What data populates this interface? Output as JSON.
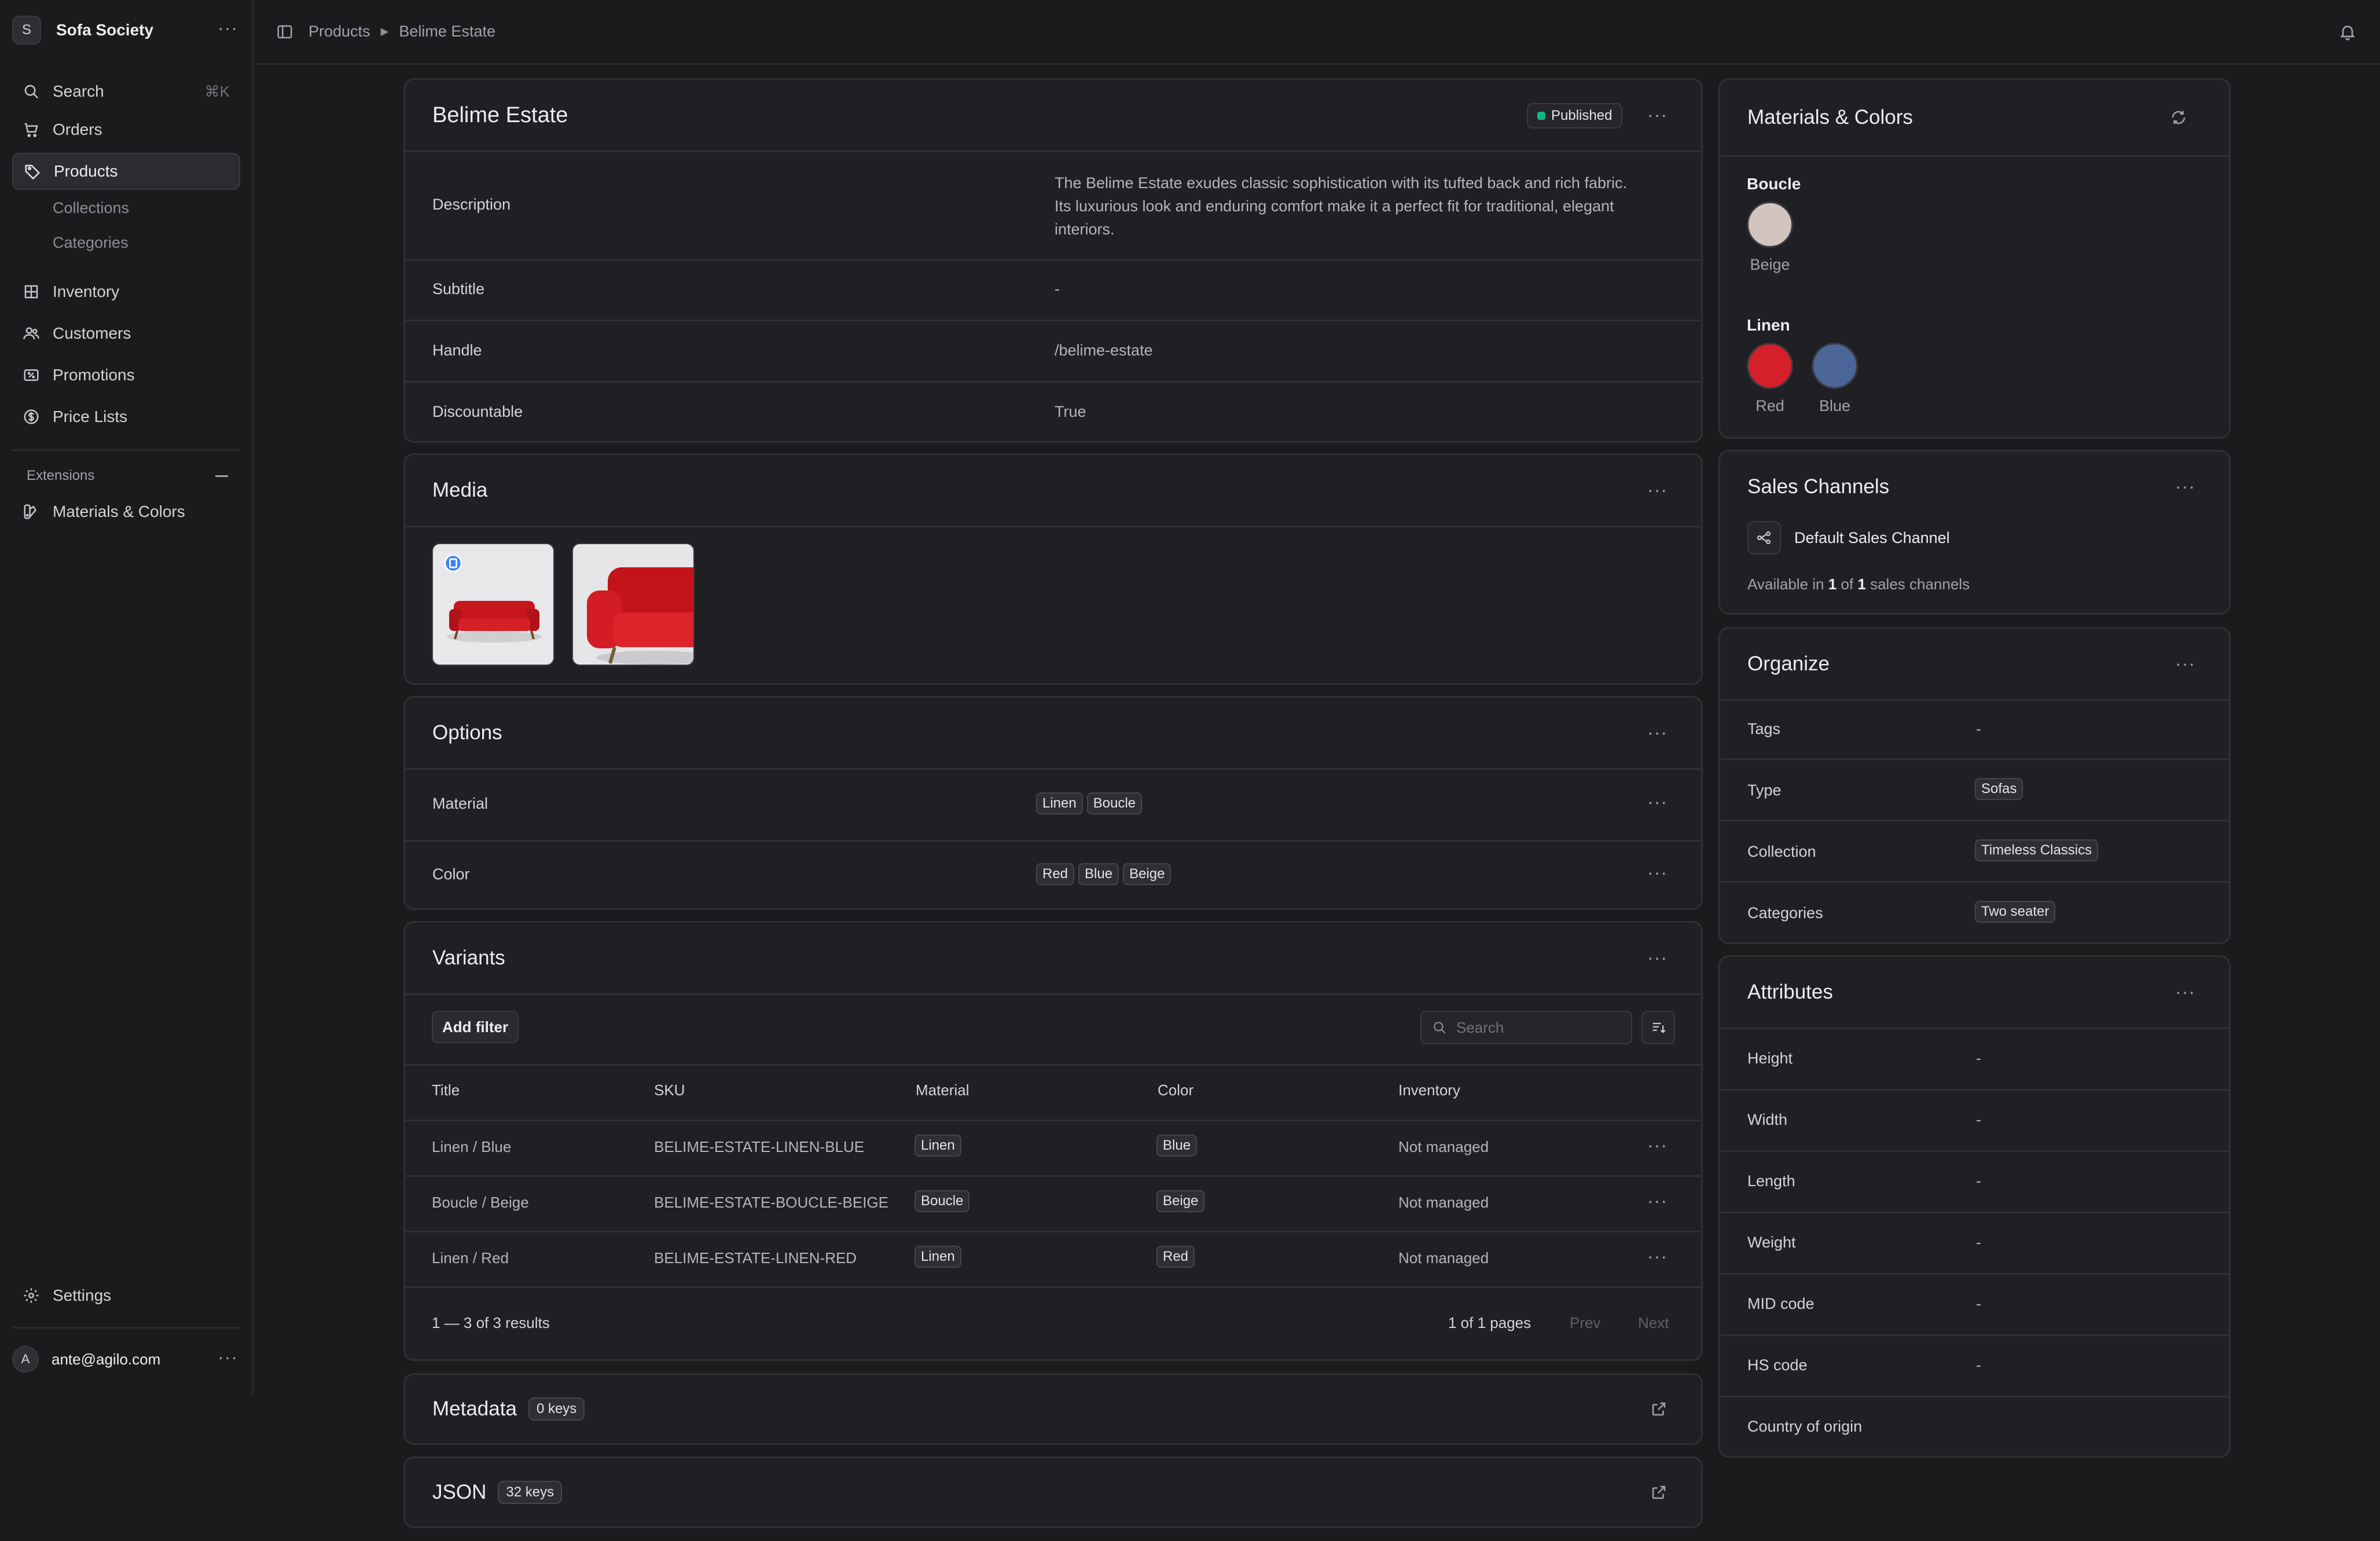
{
  "sidebar": {
    "store_initial": "S",
    "store_name": "Sofa Society",
    "nav": {
      "search": "Search",
      "search_shortcut": "⌘K",
      "orders": "Orders",
      "products": "Products",
      "collections": "Collections",
      "categories": "Categories",
      "inventory": "Inventory",
      "customers": "Customers",
      "promotions": "Promotions",
      "price_lists": "Price Lists"
    },
    "extensions_label": "Extensions",
    "extension_item": "Materials & Colors",
    "settings": "Settings",
    "user_initial": "A",
    "user_email": "ante@agilo.com"
  },
  "breadcrumb": {
    "parent": "Products",
    "current": "Belime Estate"
  },
  "product": {
    "title": "Belime Estate",
    "status": "Published",
    "status_color": "#10b981",
    "rows": {
      "description_label": "Description",
      "description_value": "The Belime Estate exudes classic sophistication with its tufted back and rich fabric. Its luxurious look and enduring comfort make it a perfect fit for traditional, elegant interiors.",
      "subtitle_label": "Subtitle",
      "subtitle_value": "-",
      "handle_label": "Handle",
      "handle_value": "/belime-estate",
      "discountable_label": "Discountable",
      "discountable_value": "True"
    }
  },
  "media": {
    "title": "Media"
  },
  "options": {
    "title": "Options",
    "material_label": "Material",
    "material_values": [
      "Linen",
      "Boucle"
    ],
    "color_label": "Color",
    "color_values": [
      "Red",
      "Blue",
      "Beige"
    ]
  },
  "variants": {
    "title": "Variants",
    "add_filter": "Add filter",
    "search_placeholder": "Search",
    "columns": [
      "Title",
      "SKU",
      "Material",
      "Color",
      "Inventory"
    ],
    "rows": [
      [
        "Linen / Blue",
        "BELIME-ESTATE-LINEN-BLUE",
        "Linen",
        "Blue",
        "Not managed"
      ],
      [
        "Boucle / Beige",
        "BELIME-ESTATE-BOUCLE-BEIGE",
        "Boucle",
        "Beige",
        "Not managed"
      ],
      [
        "Linen / Red",
        "BELIME-ESTATE-LINEN-RED",
        "Linen",
        "Red",
        "Not managed"
      ]
    ],
    "results": "1 — 3 of 3 results",
    "pages": "1 of 1 pages",
    "prev": "Prev",
    "next": "Next"
  },
  "metadata": {
    "title": "Metadata",
    "keys": "0 keys"
  },
  "json": {
    "title": "JSON",
    "keys": "32 keys"
  },
  "materials_colors": {
    "title": "Materials & Colors",
    "groups": [
      {
        "name": "Boucle",
        "colors": [
          {
            "name": "Beige",
            "hex": "#d2c4be"
          }
        ]
      },
      {
        "name": "Linen",
        "colors": [
          {
            "name": "Red",
            "hex": "#d5202a"
          },
          {
            "name": "Blue",
            "hex": "#4b6598"
          }
        ]
      }
    ]
  },
  "sales_channels": {
    "title": "Sales Channels",
    "channel": "Default Sales Channel",
    "available_prefix": "Available in",
    "available_count": "1",
    "available_of": "of",
    "available_total": "1",
    "available_suffix": "sales channels"
  },
  "organize": {
    "title": "Organize",
    "tags_label": "Tags",
    "tags_value": "-",
    "type_label": "Type",
    "type_value": "Sofas",
    "collection_label": "Collection",
    "collection_value": "Timeless Classics",
    "categories_label": "Categories",
    "categories_value": "Two seater"
  },
  "attributes": {
    "title": "Attributes",
    "rows": [
      [
        "Height",
        "-"
      ],
      [
        "Width",
        "-"
      ],
      [
        "Length",
        "-"
      ],
      [
        "Weight",
        "-"
      ],
      [
        "MID code",
        "-"
      ],
      [
        "HS code",
        "-"
      ],
      [
        "Country of origin",
        ""
      ]
    ]
  }
}
